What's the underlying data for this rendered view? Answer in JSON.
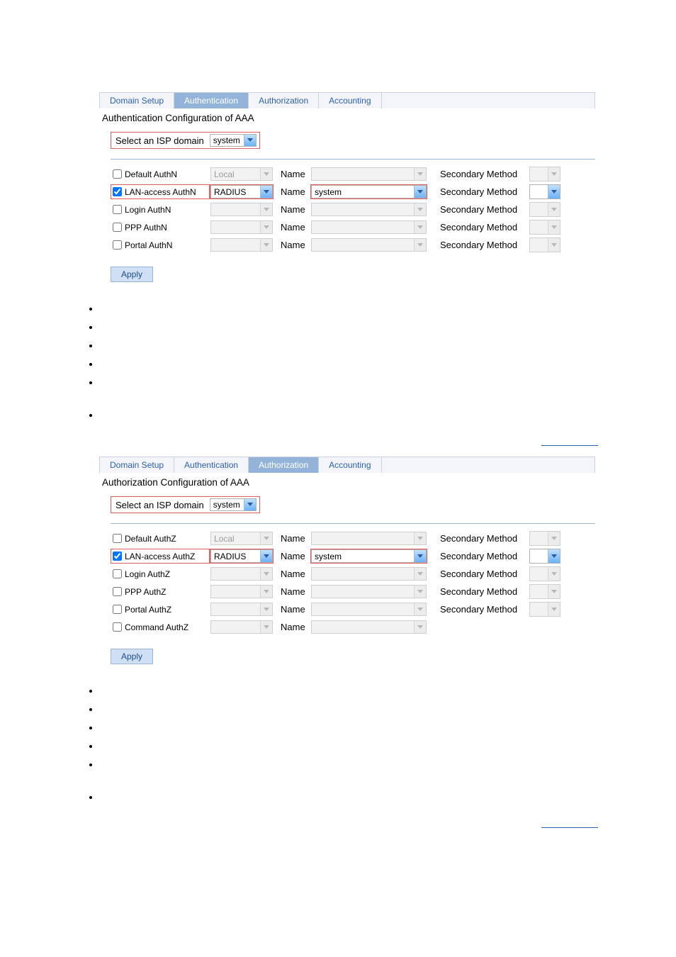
{
  "tabs": [
    "Domain Setup",
    "Authentication",
    "Authorization",
    "Accounting"
  ],
  "auth_panel": {
    "active_tab_index": 1,
    "title": "Authentication Configuration of AAA",
    "domain_label": "Select an ISP domain",
    "domain_value": "system",
    "rows": [
      {
        "label": "Default AuthN",
        "checked": false,
        "method": "Local",
        "method_enabled": false,
        "name_label": "Name",
        "name_value": "",
        "name_enabled": false,
        "sec_label": "Secondary Method",
        "sec_enabled": false
      },
      {
        "label": "LAN-access AuthN",
        "checked": true,
        "method": "RADIUS",
        "method_enabled": true,
        "name_label": "Name",
        "name_value": "system",
        "name_enabled": true,
        "sec_label": "Secondary Method",
        "sec_enabled": true
      },
      {
        "label": "Login AuthN",
        "checked": false,
        "method": "",
        "method_enabled": false,
        "name_label": "Name",
        "name_value": "",
        "name_enabled": false,
        "sec_label": "Secondary Method",
        "sec_enabled": false
      },
      {
        "label": "PPP AuthN",
        "checked": false,
        "method": "",
        "method_enabled": false,
        "name_label": "Name",
        "name_value": "",
        "name_enabled": false,
        "sec_label": "Secondary Method",
        "sec_enabled": false
      },
      {
        "label": "Portal AuthN",
        "checked": false,
        "method": "",
        "method_enabled": false,
        "name_label": "Name",
        "name_value": "",
        "name_enabled": false,
        "sec_label": "Secondary Method",
        "sec_enabled": false
      }
    ],
    "apply": "Apply"
  },
  "authz_panel": {
    "active_tab_index": 2,
    "title": "Authorization Configuration of AAA",
    "domain_label": "Select an ISP domain",
    "domain_value": "system",
    "rows": [
      {
        "label": "Default AuthZ",
        "checked": false,
        "method": "Local",
        "method_enabled": false,
        "name_label": "Name",
        "name_value": "",
        "name_enabled": false,
        "sec_label": "Secondary Method",
        "sec_enabled": false
      },
      {
        "label": "LAN-access AuthZ",
        "checked": true,
        "method": "RADIUS",
        "method_enabled": true,
        "name_label": "Name",
        "name_value": "system",
        "name_enabled": true,
        "sec_label": "Secondary Method",
        "sec_enabled": true
      },
      {
        "label": "Login AuthZ",
        "checked": false,
        "method": "",
        "method_enabled": false,
        "name_label": "Name",
        "name_value": "",
        "name_enabled": false,
        "sec_label": "Secondary Method",
        "sec_enabled": false
      },
      {
        "label": "PPP AuthZ",
        "checked": false,
        "method": "",
        "method_enabled": false,
        "name_label": "Name",
        "name_value": "",
        "name_enabled": false,
        "sec_label": "Secondary Method",
        "sec_enabled": false
      },
      {
        "label": "Portal AuthZ",
        "checked": false,
        "method": "",
        "method_enabled": false,
        "name_label": "Name",
        "name_value": "",
        "name_enabled": false,
        "sec_label": "Secondary Method",
        "sec_enabled": false
      },
      {
        "label": "Command AuthZ",
        "checked": false,
        "method": "",
        "method_enabled": false,
        "name_label": "Name",
        "name_value": "",
        "name_enabled": false,
        "sec_label": "",
        "sec_enabled": false,
        "no_secondary": true
      }
    ],
    "apply": "Apply"
  }
}
